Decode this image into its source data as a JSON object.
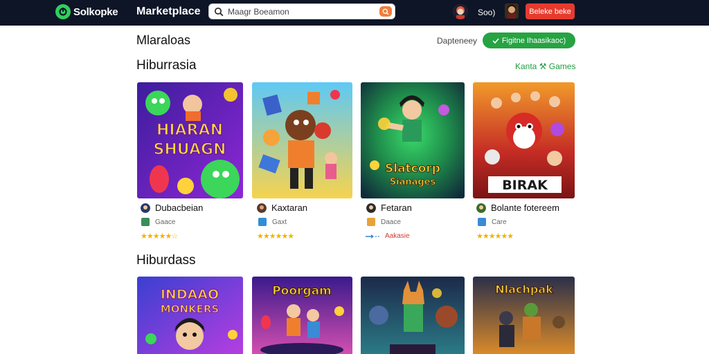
{
  "header": {
    "brand": "Solkopke",
    "nav_marketplace": "Marketplace",
    "search_placeholder": "Maagr Boeamon",
    "user_name": "Soo)",
    "cta_label": "Beleke beke"
  },
  "toolbar": {
    "page_title": "Mlaraloas",
    "filter_label": "Dapteneey",
    "green_button": "Figitne Ihaasikaoc)"
  },
  "sections": [
    {
      "title": "Hiburrasia",
      "link": "Kanta ⚒ Games",
      "cards": [
        {
          "art_title": "HIARAN SHUAGN",
          "developer": "Dubacbeian",
          "genre": "Gaace",
          "stars": "★★★★★☆",
          "rating_text": "",
          "colors": {
            "bg1": "#3c1d9c",
            "bg2": "#8e27d6"
          }
        },
        {
          "art_title": "",
          "developer": "Kaxtaran",
          "genre": "Gaxt",
          "stars": "★★★★★★",
          "rating_text": "",
          "colors": {
            "bg1": "#5ec9f5",
            "bg2": "#f6d34f"
          }
        },
        {
          "art_title": "Slatcorp Sianages",
          "developer": "Fetaran",
          "genre": "Daace",
          "stars": "",
          "rating_text": "Aakasie",
          "colors": {
            "bg1": "#0f3b4a",
            "bg2": "#1f8c4b"
          }
        },
        {
          "art_title": "BIRAK",
          "developer": "Bolante fotereem",
          "genre": "Care",
          "stars": "★★★★★★",
          "rating_text": "",
          "colors": {
            "bg1": "#c52c25",
            "bg2": "#f19a2b"
          }
        }
      ]
    },
    {
      "title": "Hiburdass",
      "cards": [
        {
          "art_title": "INDAAO MONKERS",
          "colors": {
            "bg1": "#3a3fd1",
            "bg2": "#b63ee0"
          }
        },
        {
          "art_title": "Poorgam",
          "colors": {
            "bg1": "#3a1a8c",
            "bg2": "#d34fb0"
          }
        },
        {
          "art_title": "",
          "colors": {
            "bg1": "#1c2a4a",
            "bg2": "#2b7a86"
          }
        },
        {
          "art_title": "Nlachpak",
          "colors": {
            "bg1": "#2a2f4a",
            "bg2": "#d98a2a"
          }
        }
      ]
    }
  ]
}
